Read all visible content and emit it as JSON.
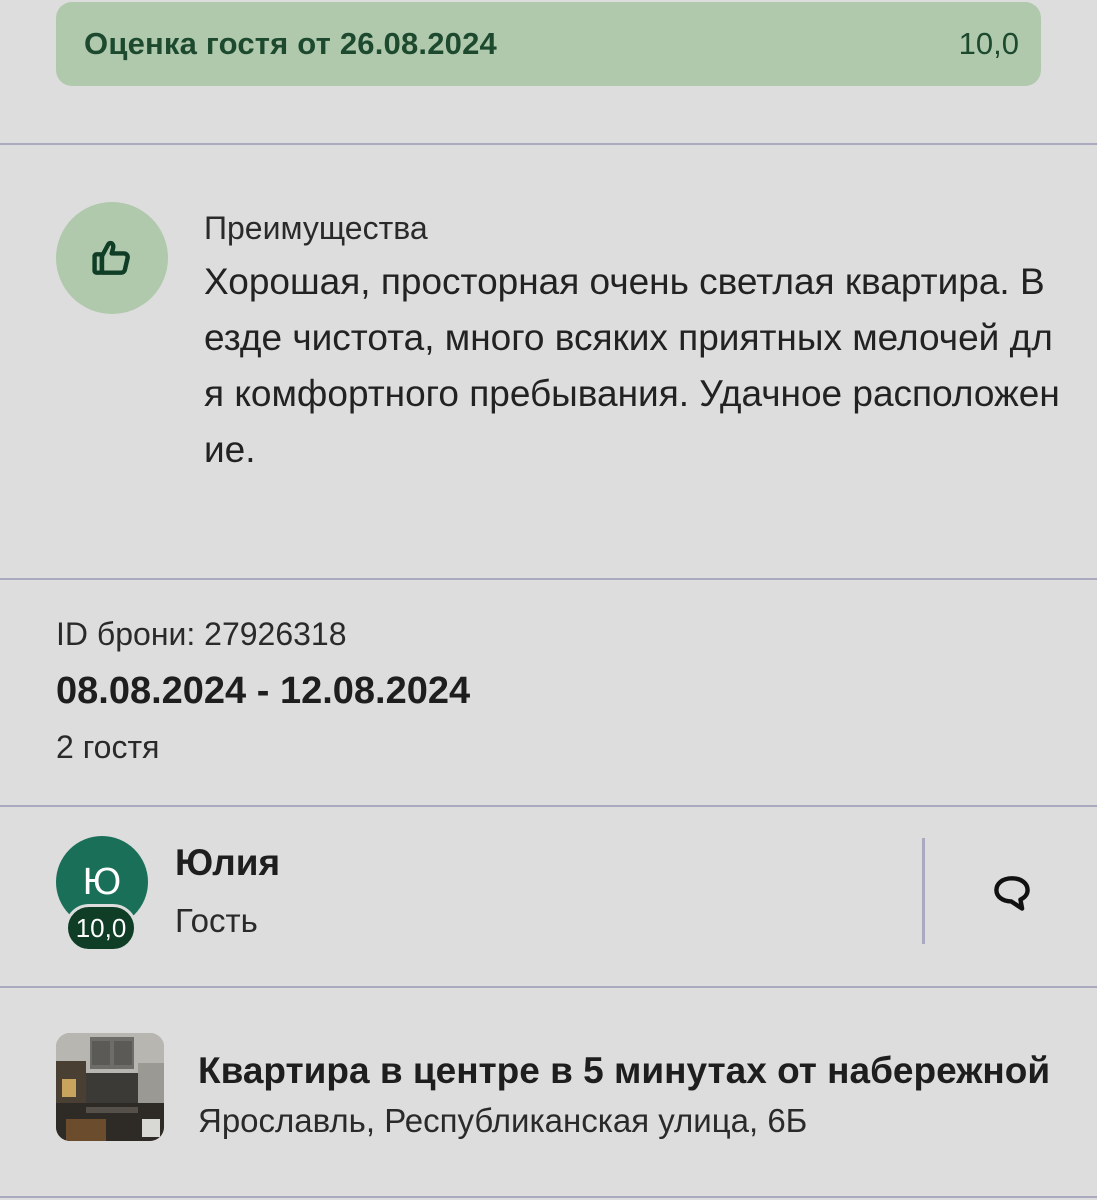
{
  "rating": {
    "title": "Оценка гостя от 26.08.2024",
    "score": "10,0"
  },
  "advantages": {
    "icon": "thumbs-up-icon",
    "heading": "Преимущества",
    "text": "Хорошая, просторная очень светлая квартира. Везде чистота, много всяких приятных мелочей для комфортного пребывания. Удачное расположение."
  },
  "booking": {
    "id_label": "ID брони: 27926318",
    "dates": "08.08.2024 - 12.08.2024",
    "guests": "2 гостя"
  },
  "guest": {
    "initial": "Ю",
    "score": "10,0",
    "name": "Юлия",
    "role": "Гость",
    "action_icon": "chat-bubble-icon"
  },
  "property": {
    "title": "Квартира в центре в 5 минутах от набережной",
    "address": "Ярославль, Республиканская улица, 6Б"
  },
  "colors": {
    "background": "#dddddd",
    "accent_green_light": "#b0c9ad",
    "accent_green_dark": "#1d4a2e",
    "avatar": "#1a6f58",
    "divider": "#a9a9bf"
  }
}
